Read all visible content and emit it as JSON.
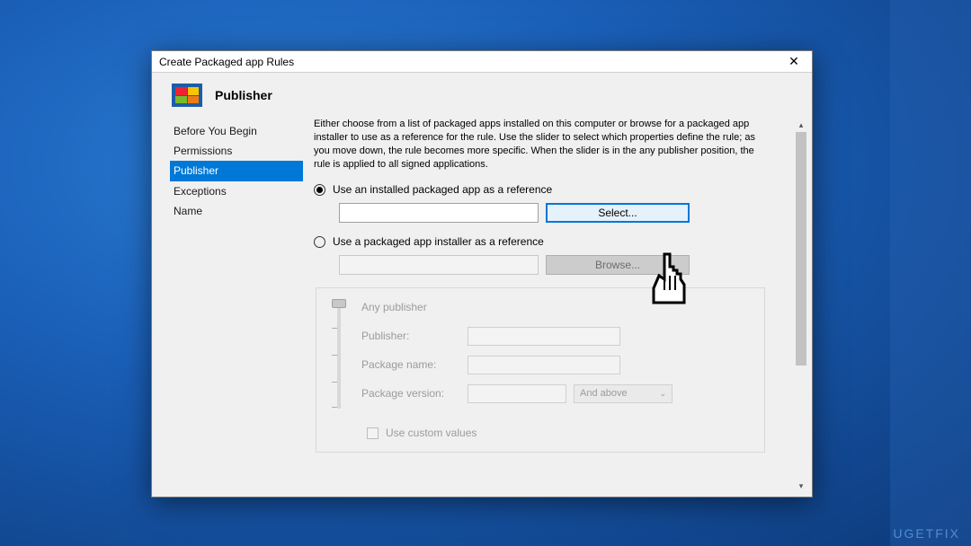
{
  "window": {
    "title": "Create Packaged app Rules"
  },
  "header": {
    "title": "Publisher"
  },
  "sidebar": {
    "items": [
      {
        "label": "Before You Begin",
        "selected": false
      },
      {
        "label": "Permissions",
        "selected": false
      },
      {
        "label": "Publisher",
        "selected": true
      },
      {
        "label": "Exceptions",
        "selected": false
      },
      {
        "label": "Name",
        "selected": false
      }
    ]
  },
  "content": {
    "description": "Either choose from a list of packaged apps installed on this computer or browse for a packaged app installer to use as a reference for the rule. Use the slider to select which properties define the rule; as you move down, the rule becomes more specific. When the slider is in the any publisher position, the rule is applied to all signed applications.",
    "option_installed": "Use an installed packaged app as a reference",
    "option_installer": "Use a packaged app installer as a reference",
    "select_button": "Select...",
    "browse_button": "Browse...",
    "slider_top_label": "Any publisher",
    "fields": {
      "publisher": "Publisher:",
      "package_name": "Package name:",
      "package_version": "Package version:"
    },
    "combo_value": "And above",
    "use_custom": "Use custom values"
  },
  "watermark": "UGETFIX"
}
